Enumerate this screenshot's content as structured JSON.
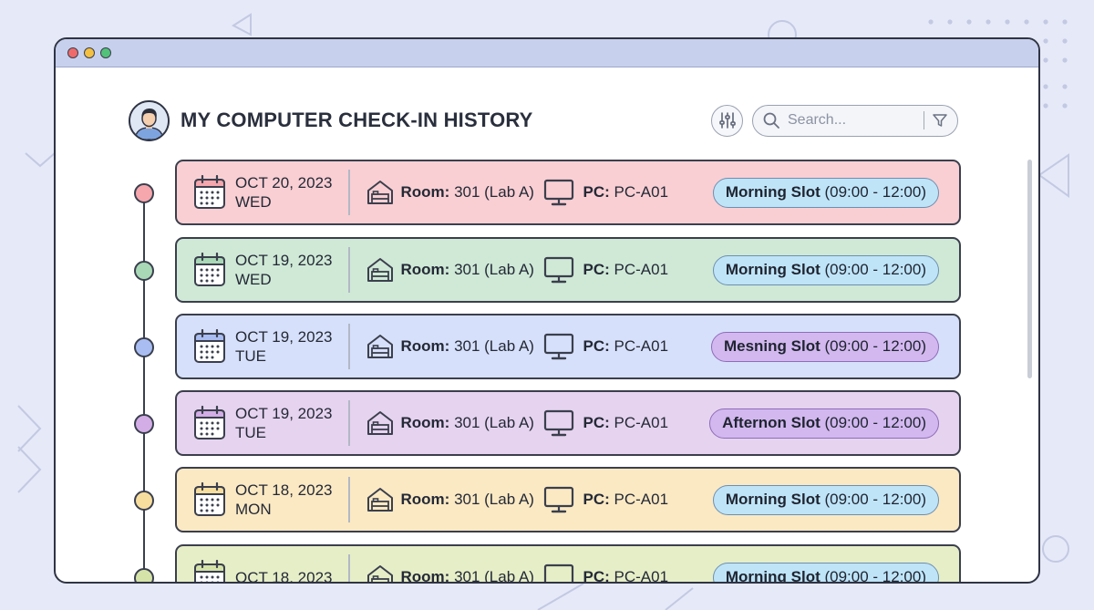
{
  "header": {
    "title": "MY COMPUTER CHECK-IN HISTORY",
    "search_placeholder": "Search...",
    "icons": [
      "avatar",
      "sliders-icon",
      "search-icon",
      "filter-icon"
    ]
  },
  "labels": {
    "room": "Room:",
    "pc": "PC:"
  },
  "colors": {
    "accent_red": "#f9cfd3",
    "accent_green": "#cfe9d6",
    "accent_blue": "#d6e0fa",
    "accent_purple": "#e6d3ef",
    "accent_yellow": "#fbe9c3",
    "accent_lime": "#e6eec7",
    "badge_blue": "#bfe4f8",
    "badge_purple": "#d2b8ef"
  },
  "entries": [
    {
      "date": "OCT 20, 2023",
      "day": "WED",
      "room_value": "301 (Lab A)",
      "pc_value": "PC-A01",
      "slot_name": "Morning Slot",
      "slot_time": "(09:00 - 12:00)"
    },
    {
      "date": "OCT 19, 2023",
      "day": "WED",
      "room_value": "301 (Lab A)",
      "pc_value": "PC-A01",
      "slot_name": "Morning Slot",
      "slot_time": "(09:00 - 12:00)"
    },
    {
      "date": "OCT 19, 2023",
      "day": "TUE",
      "room_value": "301 (Lab A)",
      "pc_value": "PC-A01",
      "slot_name": "Mesning Slot",
      "slot_time": "(09:00 - 12:00)"
    },
    {
      "date": "OCT 19, 2023",
      "day": "TUE",
      "room_value": "301 (Lab A)",
      "pc_value": "PC-A01",
      "slot_name": "Afternon Slot",
      "slot_time": "(09:00 - 12:00)"
    },
    {
      "date": "OCT 18, 2023",
      "day": "MON",
      "room_value": "301 (Lab A)",
      "pc_value": "PC-A01",
      "slot_name": "Morning Slot",
      "slot_time": "(09:00 - 12:00)"
    },
    {
      "date": "OCT 18, 2023",
      "day": "",
      "room_value": "301 (Lab A)",
      "pc_value": "PC-A01",
      "slot_name": "Morning Slot",
      "slot_time": "(09:00 - 12:00)"
    }
  ]
}
